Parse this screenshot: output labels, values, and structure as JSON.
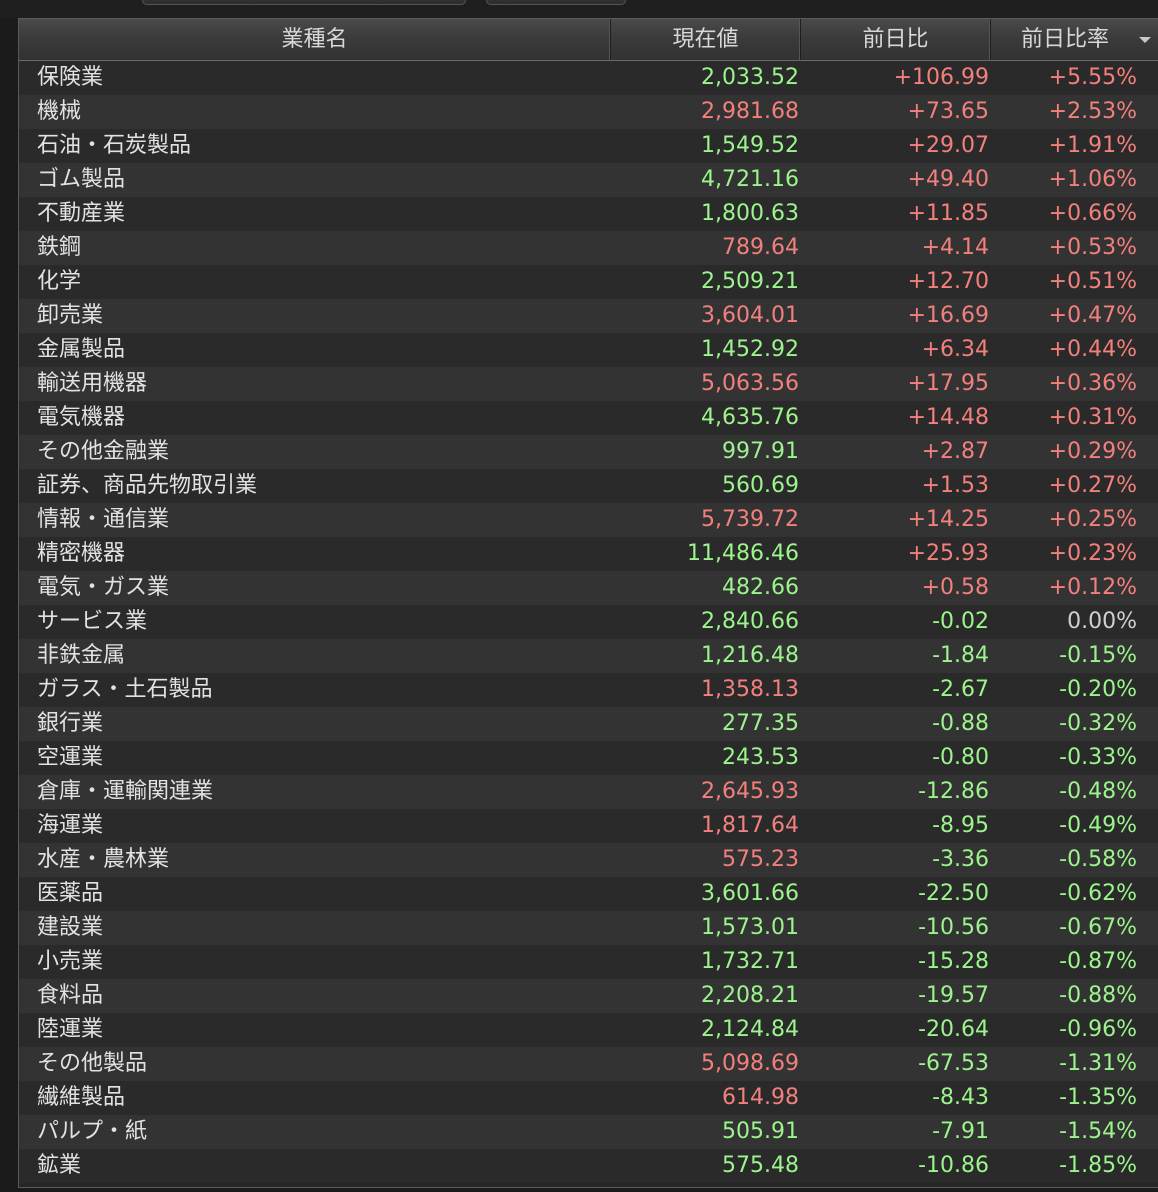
{
  "header": {
    "name": "業種名",
    "price": "現在値",
    "change": "前日比",
    "change_pct": "前日比率"
  },
  "colors": {
    "up": "#9bf58c",
    "down": "#f2807c",
    "flat": "#d0d0d0"
  },
  "rows": [
    {
      "name": "保険業",
      "price": "2,033.52",
      "price_color": "green",
      "change": "+106.99",
      "change_color": "red",
      "pct": "+5.55%",
      "pct_color": "red"
    },
    {
      "name": "機械",
      "price": "2,981.68",
      "price_color": "red",
      "change": "+73.65",
      "change_color": "red",
      "pct": "+2.53%",
      "pct_color": "red"
    },
    {
      "name": "石油・石炭製品",
      "price": "1,549.52",
      "price_color": "green",
      "change": "+29.07",
      "change_color": "red",
      "pct": "+1.91%",
      "pct_color": "red"
    },
    {
      "name": "ゴム製品",
      "price": "4,721.16",
      "price_color": "green",
      "change": "+49.40",
      "change_color": "red",
      "pct": "+1.06%",
      "pct_color": "red"
    },
    {
      "name": "不動産業",
      "price": "1,800.63",
      "price_color": "green",
      "change": "+11.85",
      "change_color": "red",
      "pct": "+0.66%",
      "pct_color": "red"
    },
    {
      "name": "鉄鋼",
      "price": "789.64",
      "price_color": "red",
      "change": "+4.14",
      "change_color": "red",
      "pct": "+0.53%",
      "pct_color": "red"
    },
    {
      "name": "化学",
      "price": "2,509.21",
      "price_color": "green",
      "change": "+12.70",
      "change_color": "red",
      "pct": "+0.51%",
      "pct_color": "red"
    },
    {
      "name": "卸売業",
      "price": "3,604.01",
      "price_color": "red",
      "change": "+16.69",
      "change_color": "red",
      "pct": "+0.47%",
      "pct_color": "red"
    },
    {
      "name": "金属製品",
      "price": "1,452.92",
      "price_color": "green",
      "change": "+6.34",
      "change_color": "red",
      "pct": "+0.44%",
      "pct_color": "red"
    },
    {
      "name": "輸送用機器",
      "price": "5,063.56",
      "price_color": "red",
      "change": "+17.95",
      "change_color": "red",
      "pct": "+0.36%",
      "pct_color": "red"
    },
    {
      "name": "電気機器",
      "price": "4,635.76",
      "price_color": "green",
      "change": "+14.48",
      "change_color": "red",
      "pct": "+0.31%",
      "pct_color": "red"
    },
    {
      "name": "その他金融業",
      "price": "997.91",
      "price_color": "green",
      "change": "+2.87",
      "change_color": "red",
      "pct": "+0.29%",
      "pct_color": "red"
    },
    {
      "name": "証券、商品先物取引業",
      "price": "560.69",
      "price_color": "green",
      "change": "+1.53",
      "change_color": "red",
      "pct": "+0.27%",
      "pct_color": "red"
    },
    {
      "name": "情報・通信業",
      "price": "5,739.72",
      "price_color": "red",
      "change": "+14.25",
      "change_color": "red",
      "pct": "+0.25%",
      "pct_color": "red"
    },
    {
      "name": "精密機器",
      "price": "11,486.46",
      "price_color": "green",
      "change": "+25.93",
      "change_color": "red",
      "pct": "+0.23%",
      "pct_color": "red"
    },
    {
      "name": "電気・ガス業",
      "price": "482.66",
      "price_color": "green",
      "change": "+0.58",
      "change_color": "red",
      "pct": "+0.12%",
      "pct_color": "red"
    },
    {
      "name": "サービス業",
      "price": "2,840.66",
      "price_color": "green",
      "change": "-0.02",
      "change_color": "green",
      "pct": "0.00%",
      "pct_color": "gray"
    },
    {
      "name": "非鉄金属",
      "price": "1,216.48",
      "price_color": "green",
      "change": "-1.84",
      "change_color": "green",
      "pct": "-0.15%",
      "pct_color": "green"
    },
    {
      "name": "ガラス・土石製品",
      "price": "1,358.13",
      "price_color": "red",
      "change": "-2.67",
      "change_color": "green",
      "pct": "-0.20%",
      "pct_color": "green"
    },
    {
      "name": "銀行業",
      "price": "277.35",
      "price_color": "green",
      "change": "-0.88",
      "change_color": "green",
      "pct": "-0.32%",
      "pct_color": "green"
    },
    {
      "name": "空運業",
      "price": "243.53",
      "price_color": "green",
      "change": "-0.80",
      "change_color": "green",
      "pct": "-0.33%",
      "pct_color": "green"
    },
    {
      "name": "倉庫・運輸関連業",
      "price": "2,645.93",
      "price_color": "red",
      "change": "-12.86",
      "change_color": "green",
      "pct": "-0.48%",
      "pct_color": "green"
    },
    {
      "name": "海運業",
      "price": "1,817.64",
      "price_color": "red",
      "change": "-8.95",
      "change_color": "green",
      "pct": "-0.49%",
      "pct_color": "green"
    },
    {
      "name": "水産・農林業",
      "price": "575.23",
      "price_color": "red",
      "change": "-3.36",
      "change_color": "green",
      "pct": "-0.58%",
      "pct_color": "green"
    },
    {
      "name": "医薬品",
      "price": "3,601.66",
      "price_color": "green",
      "change": "-22.50",
      "change_color": "green",
      "pct": "-0.62%",
      "pct_color": "green"
    },
    {
      "name": "建設業",
      "price": "1,573.01",
      "price_color": "green",
      "change": "-10.56",
      "change_color": "green",
      "pct": "-0.67%",
      "pct_color": "green"
    },
    {
      "name": "小売業",
      "price": "1,732.71",
      "price_color": "green",
      "change": "-15.28",
      "change_color": "green",
      "pct": "-0.87%",
      "pct_color": "green"
    },
    {
      "name": "食料品",
      "price": "2,208.21",
      "price_color": "green",
      "change": "-19.57",
      "change_color": "green",
      "pct": "-0.88%",
      "pct_color": "green"
    },
    {
      "name": "陸運業",
      "price": "2,124.84",
      "price_color": "green",
      "change": "-20.64",
      "change_color": "green",
      "pct": "-0.96%",
      "pct_color": "green"
    },
    {
      "name": "その他製品",
      "price": "5,098.69",
      "price_color": "red",
      "change": "-67.53",
      "change_color": "green",
      "pct": "-1.31%",
      "pct_color": "green"
    },
    {
      "name": "繊維製品",
      "price": "614.98",
      "price_color": "red",
      "change": "-8.43",
      "change_color": "green",
      "pct": "-1.35%",
      "pct_color": "green"
    },
    {
      "name": "パルプ・紙",
      "price": "505.91",
      "price_color": "green",
      "change": "-7.91",
      "change_color": "green",
      "pct": "-1.54%",
      "pct_color": "green"
    },
    {
      "name": "鉱業",
      "price": "575.48",
      "price_color": "green",
      "change": "-10.86",
      "change_color": "green",
      "pct": "-1.85%",
      "pct_color": "green"
    }
  ]
}
